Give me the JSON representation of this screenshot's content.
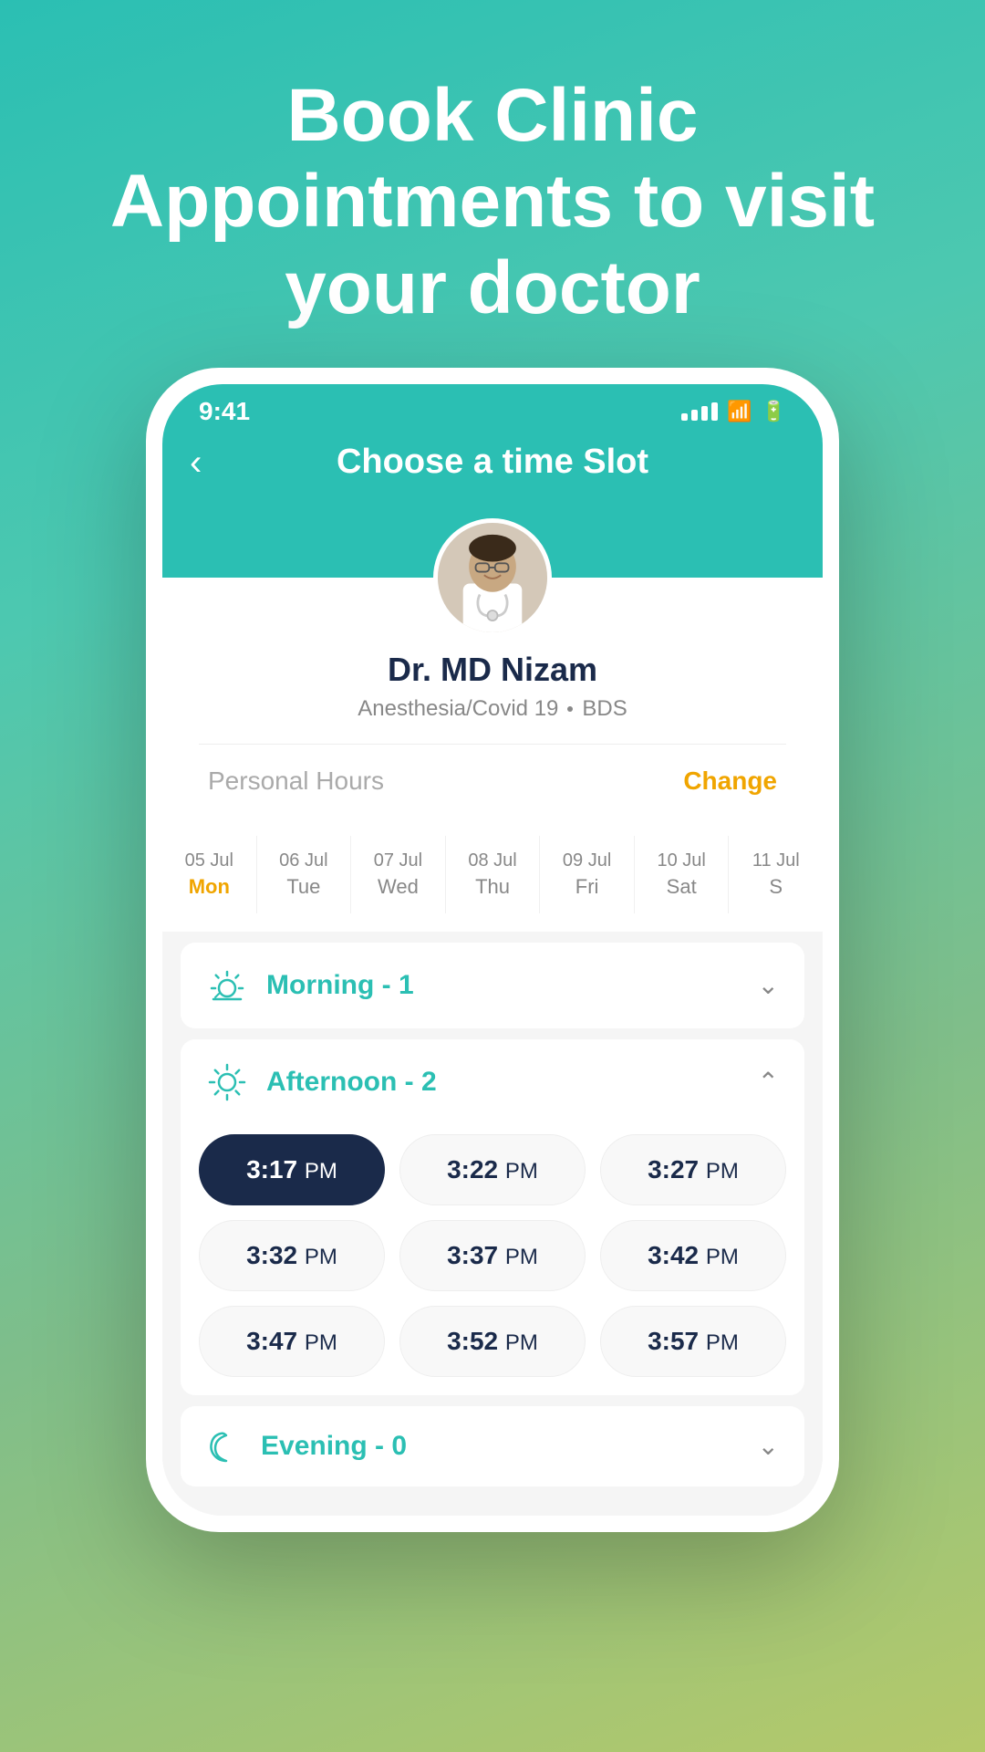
{
  "app": {
    "hero_title": "Book Clinic Appointments to visit your doctor",
    "status_time": "9:41"
  },
  "header": {
    "title": "Choose a time Slot",
    "back_label": "‹"
  },
  "doctor": {
    "name": "Dr. MD Nizam",
    "specialty": "Anesthesia/Covid 19",
    "degree": "BDS",
    "schedule_type": "Personal Hours",
    "change_label": "Change"
  },
  "dates": [
    {
      "id": "d1",
      "month": "05 Jul",
      "day": "Mon",
      "active": true
    },
    {
      "id": "d2",
      "month": "06 Jul",
      "day": "Tue",
      "active": false
    },
    {
      "id": "d3",
      "month": "07 Jul",
      "day": "Wed",
      "active": false
    },
    {
      "id": "d4",
      "month": "08 Jul",
      "day": "Thu",
      "active": false
    },
    {
      "id": "d5",
      "month": "09 Jul",
      "day": "Fri",
      "active": false
    },
    {
      "id": "d6",
      "month": "10 Jul",
      "day": "Sat",
      "active": false
    },
    {
      "id": "d7",
      "month": "11 Jul",
      "day": "Sun",
      "active": false
    }
  ],
  "time_sections": {
    "morning": {
      "label": "Morning - 1",
      "expanded": false
    },
    "afternoon": {
      "label": "Afternoon - 2",
      "expanded": true,
      "slots": [
        {
          "time": "3:17",
          "period": "PM",
          "selected": true
        },
        {
          "time": "3:22",
          "period": "PM",
          "selected": false
        },
        {
          "time": "3:27",
          "period": "PM",
          "selected": false
        },
        {
          "time": "3:32",
          "period": "PM",
          "selected": false
        },
        {
          "time": "3:37",
          "period": "PM",
          "selected": false
        },
        {
          "time": "3:42",
          "period": "PM",
          "selected": false
        },
        {
          "time": "3:47",
          "period": "PM",
          "selected": false
        },
        {
          "time": "3:52",
          "period": "PM",
          "selected": false
        },
        {
          "time": "3:57",
          "period": "PM",
          "selected": false
        }
      ]
    },
    "evening": {
      "label": "Evening - 0",
      "expanded": false
    }
  }
}
